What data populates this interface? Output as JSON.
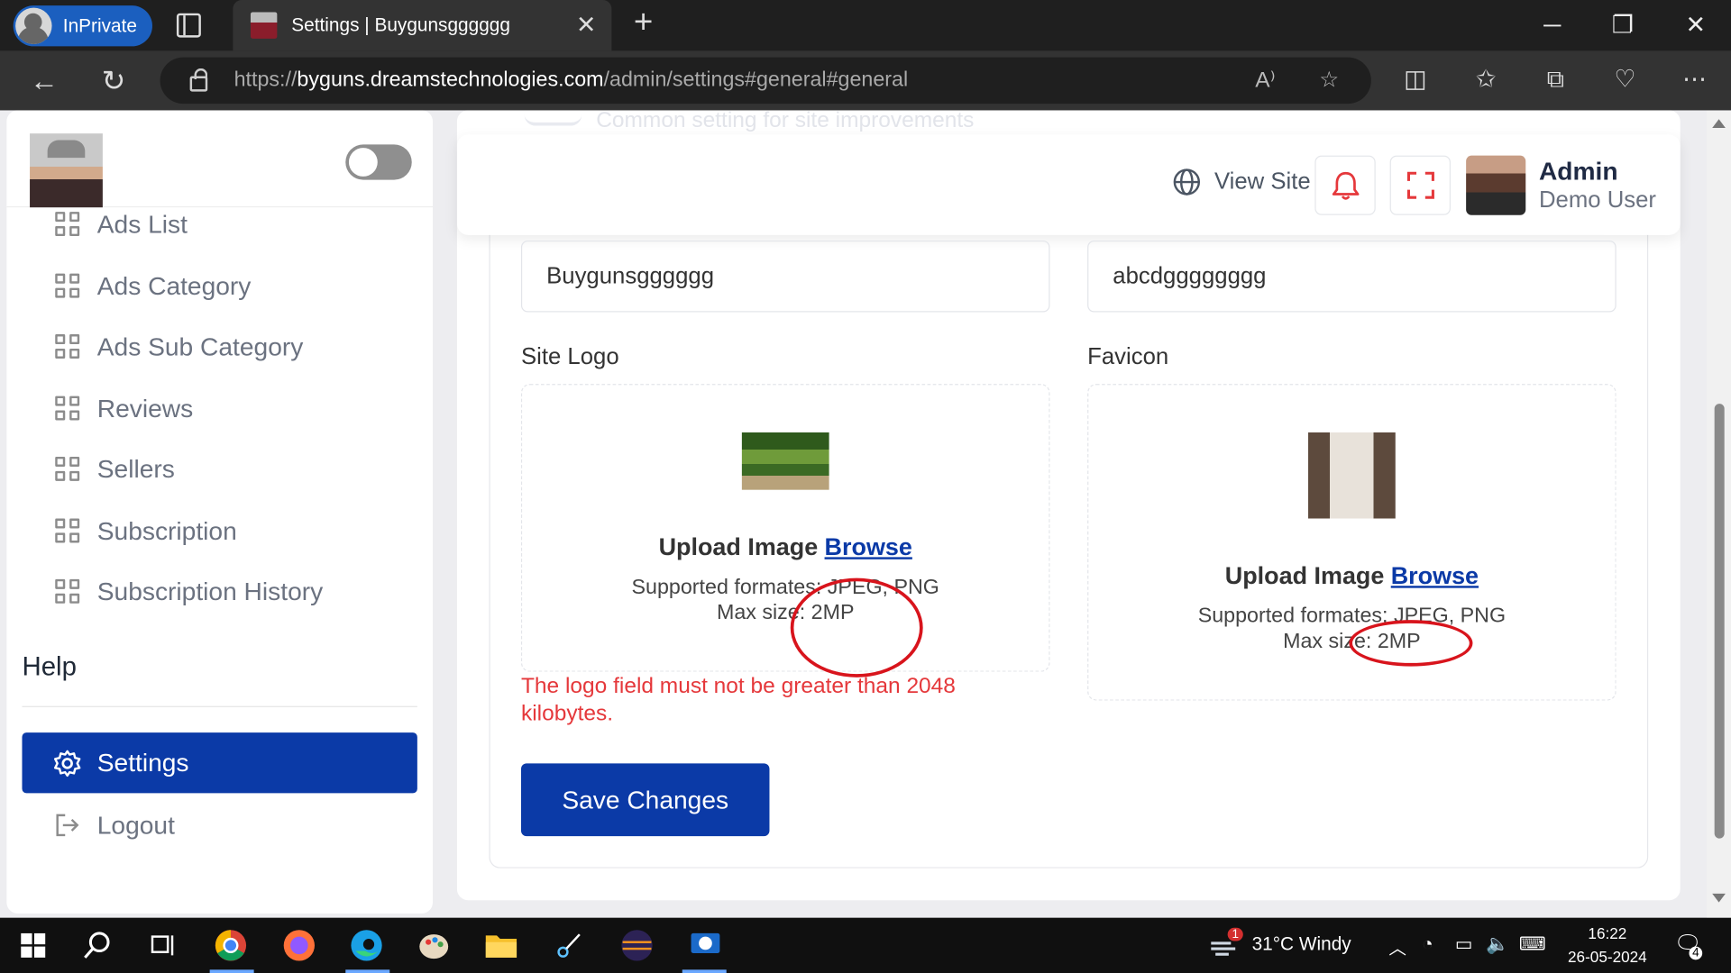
{
  "browser": {
    "inprivate_label": "InPrivate",
    "tab_title": "Settings | Buygunsgggggg",
    "url_prefix": "https://",
    "url_host": "byguns.dreamstechnologies.com",
    "url_path": "/admin/settings#general#general"
  },
  "page": {
    "faded_subtitle": "Common setting for site improvements"
  },
  "sidebar": {
    "items": [
      {
        "label": "Ads List",
        "icon": "grid-icon"
      },
      {
        "label": "Ads Category",
        "icon": "grid-icon"
      },
      {
        "label": "Ads Sub Category",
        "icon": "grid-icon"
      },
      {
        "label": "Reviews",
        "icon": "grid-icon"
      },
      {
        "label": "Sellers",
        "icon": "grid-icon"
      },
      {
        "label": "Subscription",
        "icon": "grid-icon"
      },
      {
        "label": "Subscription History",
        "icon": "grid-icon"
      }
    ],
    "section_help": "Help",
    "settings_label": "Settings",
    "logout_label": "Logout"
  },
  "header": {
    "view_site": "View Site",
    "user_name": "Admin",
    "user_role": "Demo User"
  },
  "form": {
    "site_name_value": "Buygunsgggggg",
    "site_tagline_value": "abcdgggggggg",
    "logo_label": "Site Logo",
    "favicon_label": "Favicon",
    "upload_title": "Upload Image",
    "browse_link": "Browse",
    "formats_text": "Supported formates: JPEG, PNG",
    "max_size_text": "Max size: 2MP",
    "error_text": "The logo field must not be greater than 2048 kilobytes.",
    "save_button": "Save Changes"
  },
  "taskbar": {
    "weather": "31°C  Windy",
    "time": "16:22",
    "date": "26-05-2024",
    "notif_count": "4",
    "weather_badge": "1"
  },
  "colors": {
    "primary": "#0b3aa7",
    "error": "#e5383b",
    "annotation": "#d8141c"
  }
}
